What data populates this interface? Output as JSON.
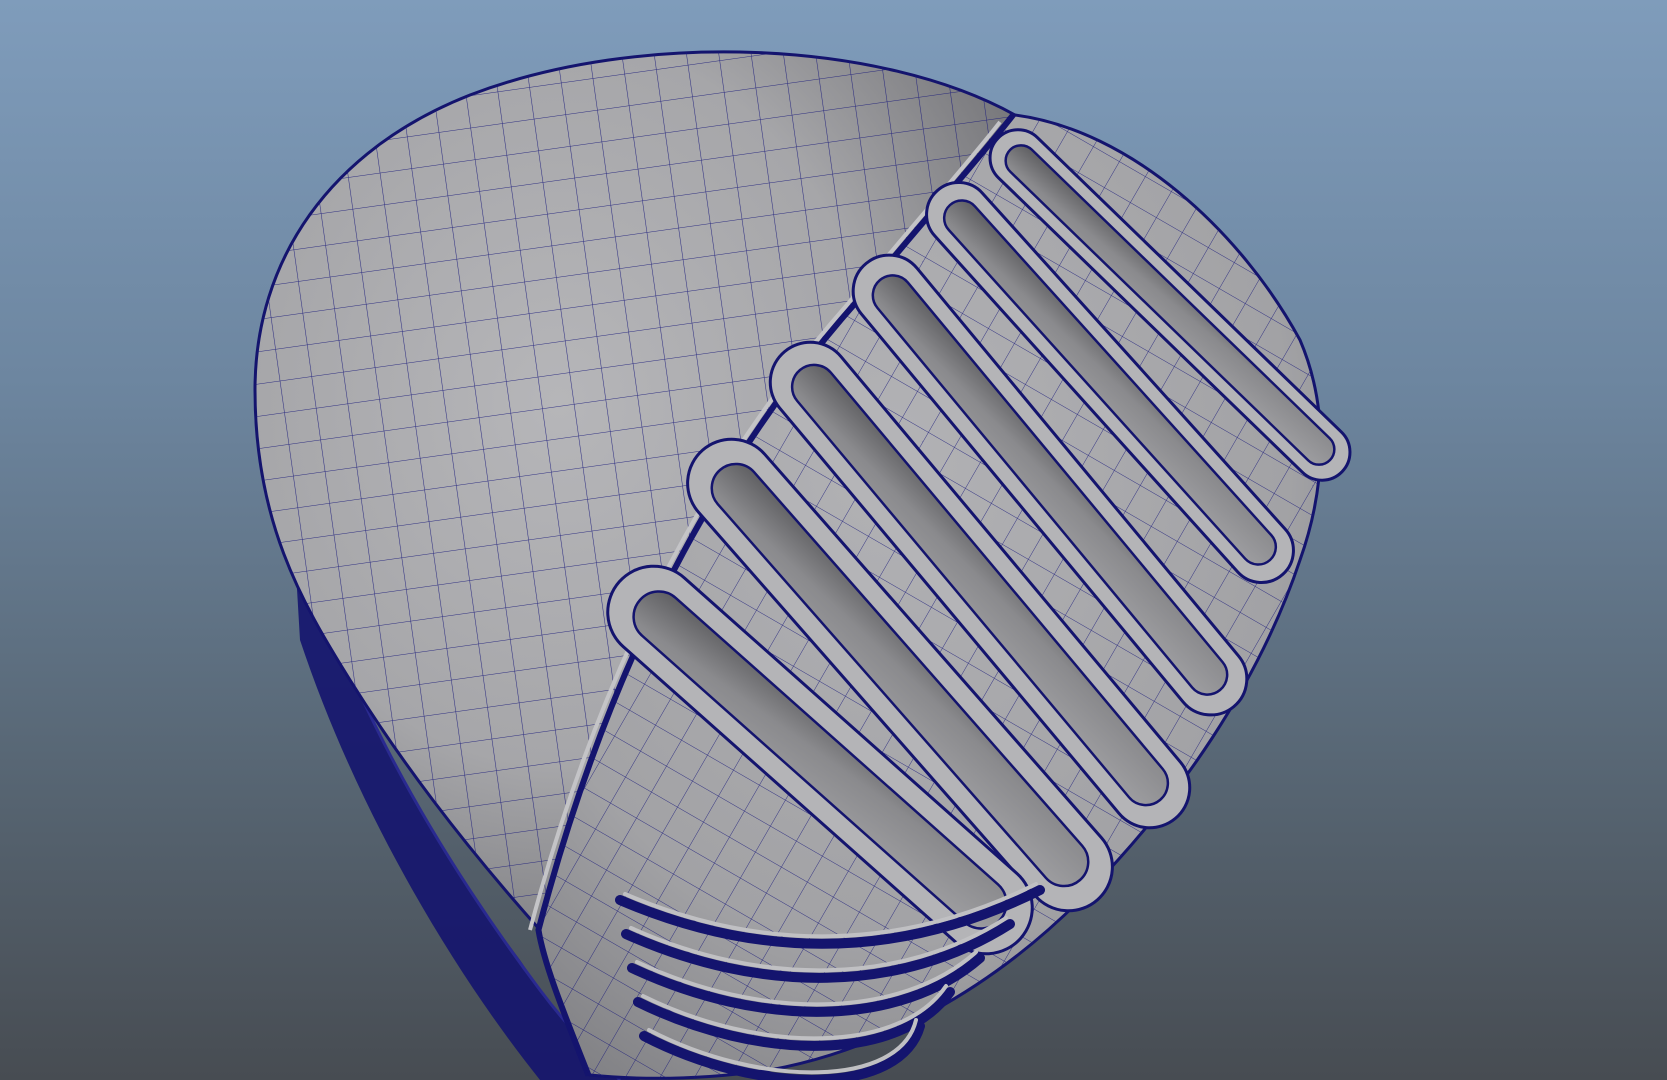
{
  "viewport": {
    "kind": "3d-modeling-viewport",
    "object": "microphone-head-mesh",
    "display_mode": "smooth-shaded-with-wireframe",
    "colors": {
      "background_top": "#7f9cbb",
      "background_bottom": "#474c52",
      "surface": "#a9a9ac",
      "surface_shadow": "#5f5f62",
      "wireframe": "#1a1a7a",
      "slot_interior": "#7d7d80"
    }
  }
}
